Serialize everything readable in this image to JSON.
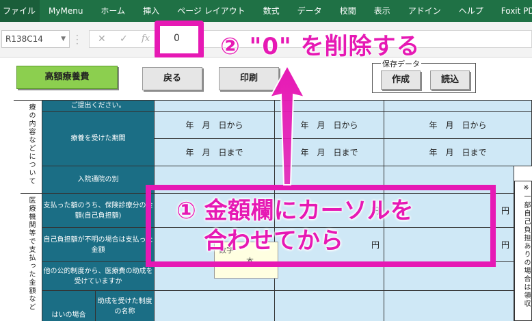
{
  "ribbon": {
    "tabs": [
      "ファイル",
      "MyMenu",
      "ホーム",
      "挿入",
      "ページ レイアウト",
      "数式",
      "データ",
      "校閲",
      "表示",
      "アドイン",
      "ヘルプ",
      "Foxit PD"
    ]
  },
  "formula_bar": {
    "name_box": "R138C14",
    "value": "0",
    "cancel_icon": "✕",
    "enter_icon": "✓",
    "fx_label": "fx"
  },
  "buttons": {
    "high_cost": "高額療養費",
    "back": "戻る",
    "print": "印刷"
  },
  "save_data": {
    "legend": "保存データ",
    "create": "作成",
    "load": "読込"
  },
  "table": {
    "top_note": "ご提出ください。",
    "section_treatment": "療の内容などについて",
    "row_period_label": "療養を受けた期間",
    "period_from": "年　月　日から",
    "period_to": "年　月　日まで",
    "row_inpatient_label": "入院通院の別",
    "section_institution": "医療機関等で支払った金額など",
    "row_paid_label": "支払った額のうち、保険診療分の金額(自己負担額)",
    "row_unknown_label": "自己負担額が不明の場合は支払った金額",
    "row_public_label": "他の公的制度から、医療費の助成を受けていますか",
    "row_yes_label": "はいの場合",
    "row_system_label": "助成を受けた制度の名称",
    "yen": "円",
    "right_note": "※一部自己負担ありの場合は領収"
  },
  "tooltip": {
    "line1": "数字",
    "line2": "本"
  },
  "annotations": {
    "step2": "② \"0\" を削除する",
    "step1_line1": "① 金額欄にカーソルを",
    "step1_line2": "合わせてから"
  },
  "colors": {
    "ribbon": "#1f7145",
    "teal": "#1b6e85",
    "light_blue": "#cfe8f6",
    "highlight": "#e619b4",
    "green_button": "#8ccf4f"
  }
}
